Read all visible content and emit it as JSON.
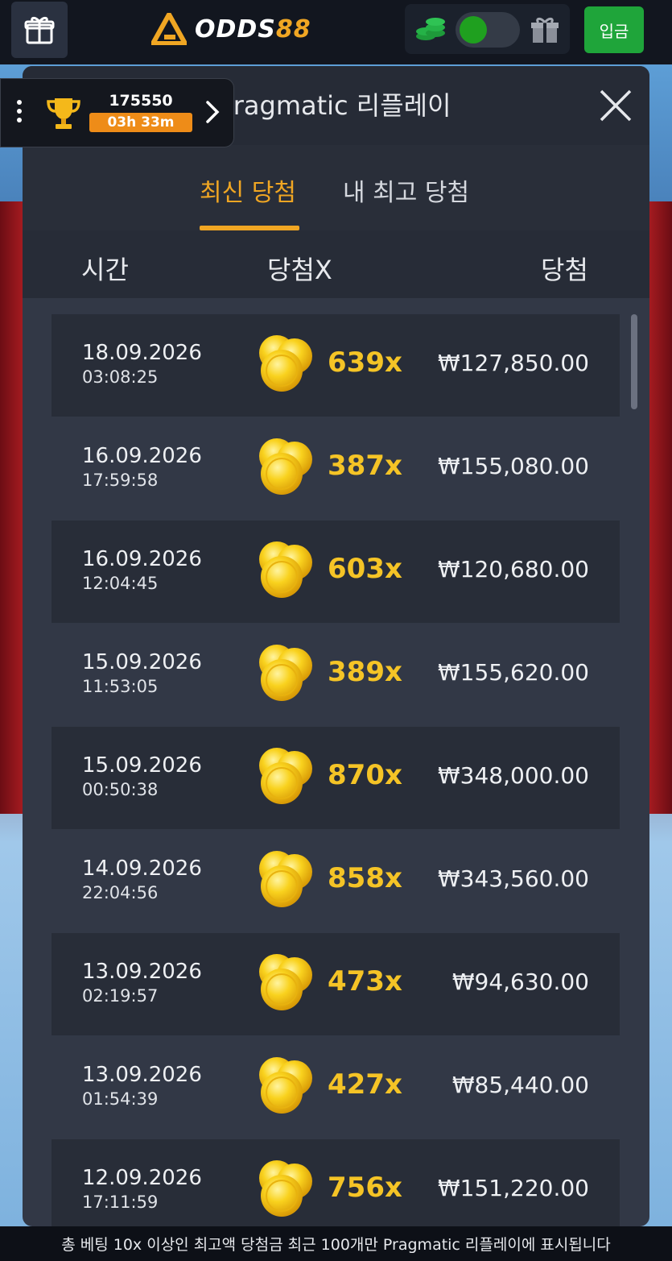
{
  "topbar": {
    "logo_text": "ODDS",
    "logo_num": "88",
    "deposit_label": "입금",
    "accent": "#f0a623",
    "deposit_color": "#1fa53a"
  },
  "tournament": {
    "score": "175550",
    "timer": "03h 33m"
  },
  "modal": {
    "title": "Pragmatic 리플레이",
    "tabs": [
      "최신 당첨",
      "내 최고 당첨"
    ],
    "active_tab": 0,
    "columns": [
      "시간",
      "당첨X",
      "당첨"
    ],
    "rows": [
      {
        "date": "18.09.2026",
        "time": "03:08:25",
        "mult": "639x",
        "win": "₩127,850.00"
      },
      {
        "date": "16.09.2026",
        "time": "17:59:58",
        "mult": "387x",
        "win": "₩155,080.00"
      },
      {
        "date": "16.09.2026",
        "time": "12:04:45",
        "mult": "603x",
        "win": "₩120,680.00"
      },
      {
        "date": "15.09.2026",
        "time": "11:53:05",
        "mult": "389x",
        "win": "₩155,620.00"
      },
      {
        "date": "15.09.2026",
        "time": "00:50:38",
        "mult": "870x",
        "win": "₩348,000.00"
      },
      {
        "date": "14.09.2026",
        "time": "22:04:56",
        "mult": "858x",
        "win": "₩343,560.00"
      },
      {
        "date": "13.09.2026",
        "time": "02:19:57",
        "mult": "473x",
        "win": "₩94,630.00"
      },
      {
        "date": "13.09.2026",
        "time": "01:54:39",
        "mult": "427x",
        "win": "₩85,440.00"
      },
      {
        "date": "12.09.2026",
        "time": "17:11:59",
        "mult": "756x",
        "win": "₩151,220.00"
      }
    ]
  },
  "footer_note": "총 베팅 10x 이상인 최고액 당첨금 최근 100개만 Pragmatic 리플레이에 표시됩니다"
}
